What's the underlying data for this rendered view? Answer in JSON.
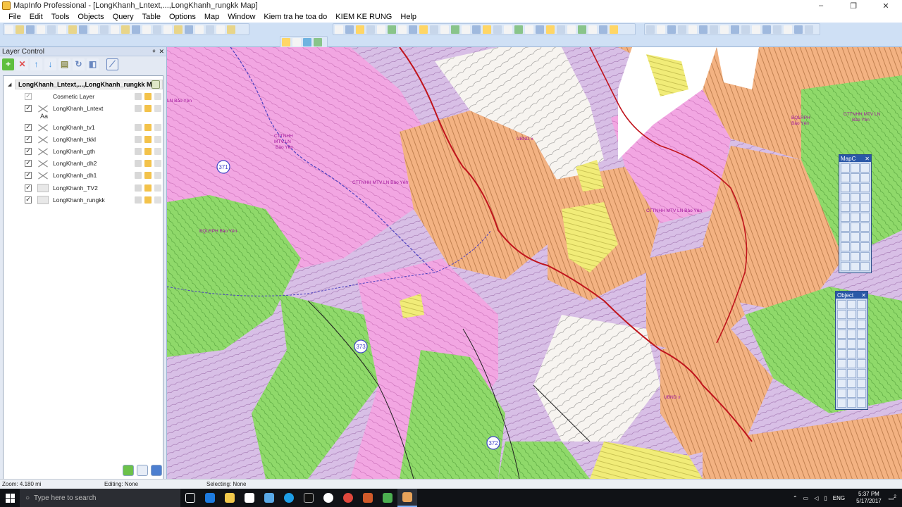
{
  "window": {
    "title": "MapInfo Professional - [LongKhanh_Lntext,...,LongKhanh_rungkk Map]",
    "controls": [
      "–",
      "❐",
      "✕"
    ]
  },
  "menu": [
    "File",
    "Edit",
    "Tools",
    "Objects",
    "Query",
    "Table",
    "Options",
    "Map",
    "Window",
    "Kiem tra he toa do",
    "KIEM KE RUNG",
    "Help"
  ],
  "layer_control": {
    "title": "Layer Control",
    "header_controls": [
      "ᵠ",
      "✕"
    ],
    "map_name": "LongKhanh_Lntext,...,LongKhanh_rungkk Map",
    "aa_label": "Aa",
    "layers": [
      {
        "name": "Cosmetic Layer",
        "checked": true
      },
      {
        "name": "LongKhanh_Lntext",
        "checked": true
      },
      {
        "name": "LongKhanh_tv1",
        "checked": true
      },
      {
        "name": "LongKhanh_tkkl",
        "checked": true
      },
      {
        "name": "LongKhanh_gth",
        "checked": true
      },
      {
        "name": "LongKhanh_dh2",
        "checked": true
      },
      {
        "name": "LongKhanh_dh1",
        "checked": true
      },
      {
        "name": "LongKhanh_TV2",
        "checked": true
      },
      {
        "name": "LongKhanh_rungkk",
        "checked": true
      }
    ]
  },
  "map_labels": {
    "cttnhh_1": "CTTNHH",
    "cttnhh_1b": "MTV LN",
    "cttnhh_1c": "Bảo Yên",
    "cttnhh_2": "CTTNHH MTV LN Bảo Yên",
    "cttnhh_3": "CTTNHH MTV LN Bảo Yên",
    "cttnhh_4": "CTTNHH MTV LN",
    "cttnhh_4b": "Bảo Yên",
    "bqlrph_1": "BQLRPH Bảo Yên",
    "bqlrph_2": "BQLRPH",
    "bqlrph_2b": "Bảo Yên",
    "ubnd_1": "UBND x",
    "ubnd_2": "UBND x",
    "road_371": "371",
    "road_373": "373",
    "road_372": "372",
    "ln_bao_yen": "LN Bảo Yên"
  },
  "palettes": {
    "mapc": "MapC",
    "object": "Object",
    "close": "✕"
  },
  "status": {
    "zoom": "Zoom: 4.180 mi",
    "editing": "Editing: None",
    "selecting": "Selecting: None"
  },
  "taskbar": {
    "search_placeholder": "Type here to search",
    "language": "ENG",
    "time": "5:37 PM",
    "date": "5/17/2017",
    "notifications": "2"
  }
}
